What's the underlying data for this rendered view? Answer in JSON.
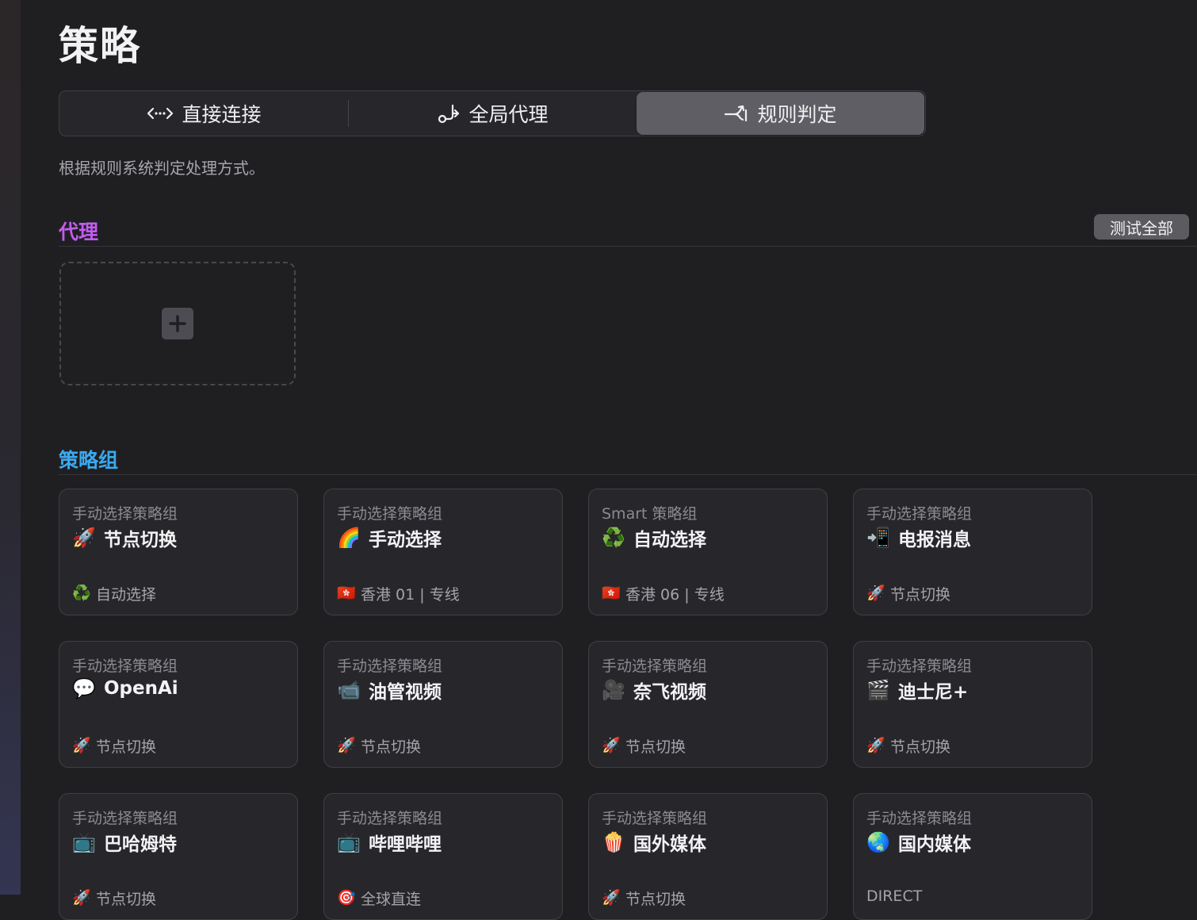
{
  "page": {
    "title": "策略",
    "mode_description": "根据规则系统判定处理方式。"
  },
  "modes": [
    {
      "label": "直接连接",
      "icon": "direct-connection-icon",
      "active": false
    },
    {
      "label": "全局代理",
      "icon": "global-proxy-icon",
      "active": false
    },
    {
      "label": "规则判定",
      "icon": "rule-based-icon",
      "active": true
    }
  ],
  "proxy_section": {
    "title": "代理",
    "title_color": "#c25cf0",
    "test_all_label": "测试全部",
    "add_icon": "plus-icon"
  },
  "group_section": {
    "title": "策略组",
    "title_color": "#3ba9ef"
  },
  "groups": [
    {
      "type": "手动选择策略组",
      "icon": "🚀",
      "name": "节点切换",
      "selected_icon": "♻️",
      "selected": "自动选择"
    },
    {
      "type": "手动选择策略组",
      "icon": "🌈",
      "name": "手动选择",
      "selected_icon": "🇭🇰",
      "selected": "香港 01 | 专线"
    },
    {
      "type": "Smart 策略组",
      "icon": "♻️",
      "name": "自动选择",
      "selected_icon": "🇭🇰",
      "selected": "香港 06 | 专线"
    },
    {
      "type": "手动选择策略组",
      "icon": "📲",
      "name": "电报消息",
      "selected_icon": "🚀",
      "selected": "节点切换"
    },
    {
      "type": "手动选择策略组",
      "icon": "💬",
      "name": "OpenAi",
      "selected_icon": "🚀",
      "selected": "节点切换"
    },
    {
      "type": "手动选择策略组",
      "icon": "📹",
      "name": "油管视频",
      "selected_icon": "🚀",
      "selected": "节点切换"
    },
    {
      "type": "手动选择策略组",
      "icon": "🎥",
      "name": "奈飞视频",
      "selected_icon": "🚀",
      "selected": "节点切换"
    },
    {
      "type": "手动选择策略组",
      "icon": "🎬",
      "name": "迪士尼+",
      "selected_icon": "🚀",
      "selected": "节点切换"
    },
    {
      "type": "手动选择策略组",
      "icon": "📺",
      "name": "巴哈姆特",
      "selected_icon": "🚀",
      "selected": "节点切换"
    },
    {
      "type": "手动选择策略组",
      "icon": "📺",
      "name": "哔哩哔哩",
      "selected_icon": "🎯",
      "selected": "全球直连"
    },
    {
      "type": "手动选择策略组",
      "icon": "🍿",
      "name": "国外媒体",
      "selected_icon": "🚀",
      "selected": "节点切换"
    },
    {
      "type": "手动选择策略组",
      "icon": "🌏",
      "name": "国内媒体",
      "selected_icon": "",
      "selected": "DIRECT"
    }
  ]
}
